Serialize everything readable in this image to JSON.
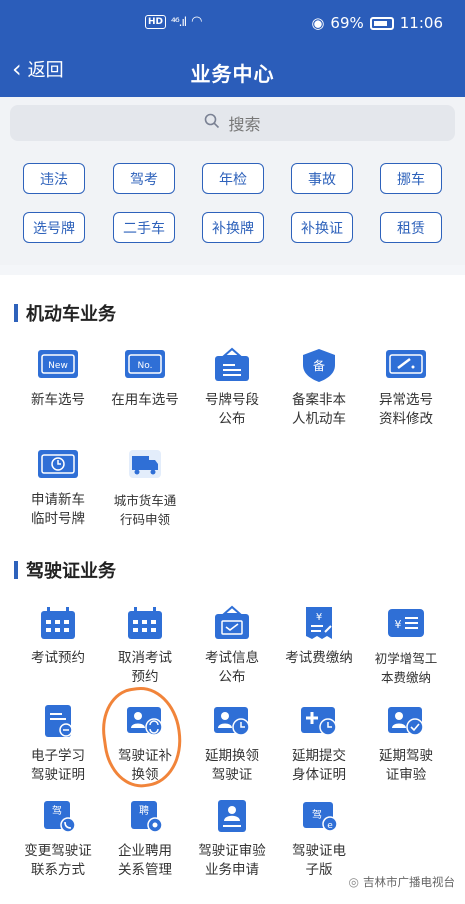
{
  "status_bar": {
    "hd": "HD",
    "signal": "⁴⁶.ıl",
    "battery": "69%",
    "time": "11:06"
  },
  "nav": {
    "back_label": "返回",
    "title": "业务中心"
  },
  "search": {
    "placeholder": "搜索"
  },
  "chips": [
    "违法",
    "驾考",
    "年检",
    "事故",
    "挪车",
    "选号牌",
    "二手车",
    "补换牌",
    "补换证",
    "租赁"
  ],
  "sections": [
    {
      "title": "机动车业务",
      "items": [
        {
          "label": "新车选号",
          "icon": "new-card-icon",
          "badge": "New"
        },
        {
          "label": "在用车选号",
          "icon": "no-card-icon",
          "badge": "No."
        },
        {
          "label": "号牌号段\n公布",
          "icon": "plate-sign-icon"
        },
        {
          "label": "备案非本\n人机动车",
          "icon": "shield-record-icon",
          "badge": "备"
        },
        {
          "label": "异常选号\n资料修改",
          "icon": "edit-card-icon"
        },
        {
          "label": "申请新车\n临时号牌",
          "icon": "clock-card-icon"
        },
        {
          "label": "城市货车通\n行码申领",
          "icon": "truck-icon"
        }
      ]
    },
    {
      "title": "驾驶证业务",
      "items": [
        {
          "label": "考试预约",
          "icon": "calendar-icon"
        },
        {
          "label": "取消考试\n预约",
          "icon": "calendar-cancel-icon"
        },
        {
          "label": "考试信息\n公布",
          "icon": "notice-board-icon"
        },
        {
          "label": "考试费缴纳",
          "icon": "fee-bill-icon",
          "badge": "¥"
        },
        {
          "label": "初学增驾工\n本费缴纳",
          "icon": "fee-list-icon",
          "badge": "¥"
        },
        {
          "label": "电子学习\n驾驶证明",
          "icon": "e-document-icon"
        },
        {
          "label": "驾驶证补\n换领",
          "icon": "license-renew-icon"
        },
        {
          "label": "延期换领\n驾驶证",
          "icon": "license-delay-icon"
        },
        {
          "label": "延期提交\n身体证明",
          "icon": "health-delay-icon"
        },
        {
          "label": "延期驾驶\n证审验",
          "icon": "license-verify-icon"
        },
        {
          "label": "变更驾驶证\n联系方式",
          "icon": "license-contact-icon",
          "badge": "驾"
        },
        {
          "label": "企业聘用\n关系管理",
          "icon": "employ-manage-icon",
          "badge": "聘"
        },
        {
          "label": "驾驶证审验\n业务申请",
          "icon": "license-audit-icon"
        },
        {
          "label": "驾驶证电\n子版",
          "icon": "e-license-icon",
          "badge": "驾"
        }
      ]
    }
  ],
  "watermark": "吉林市广播电视台",
  "colors": {
    "primary": "#2b5dba",
    "icon_blue": "#2f6fd6",
    "annotation": "#f1843a"
  }
}
